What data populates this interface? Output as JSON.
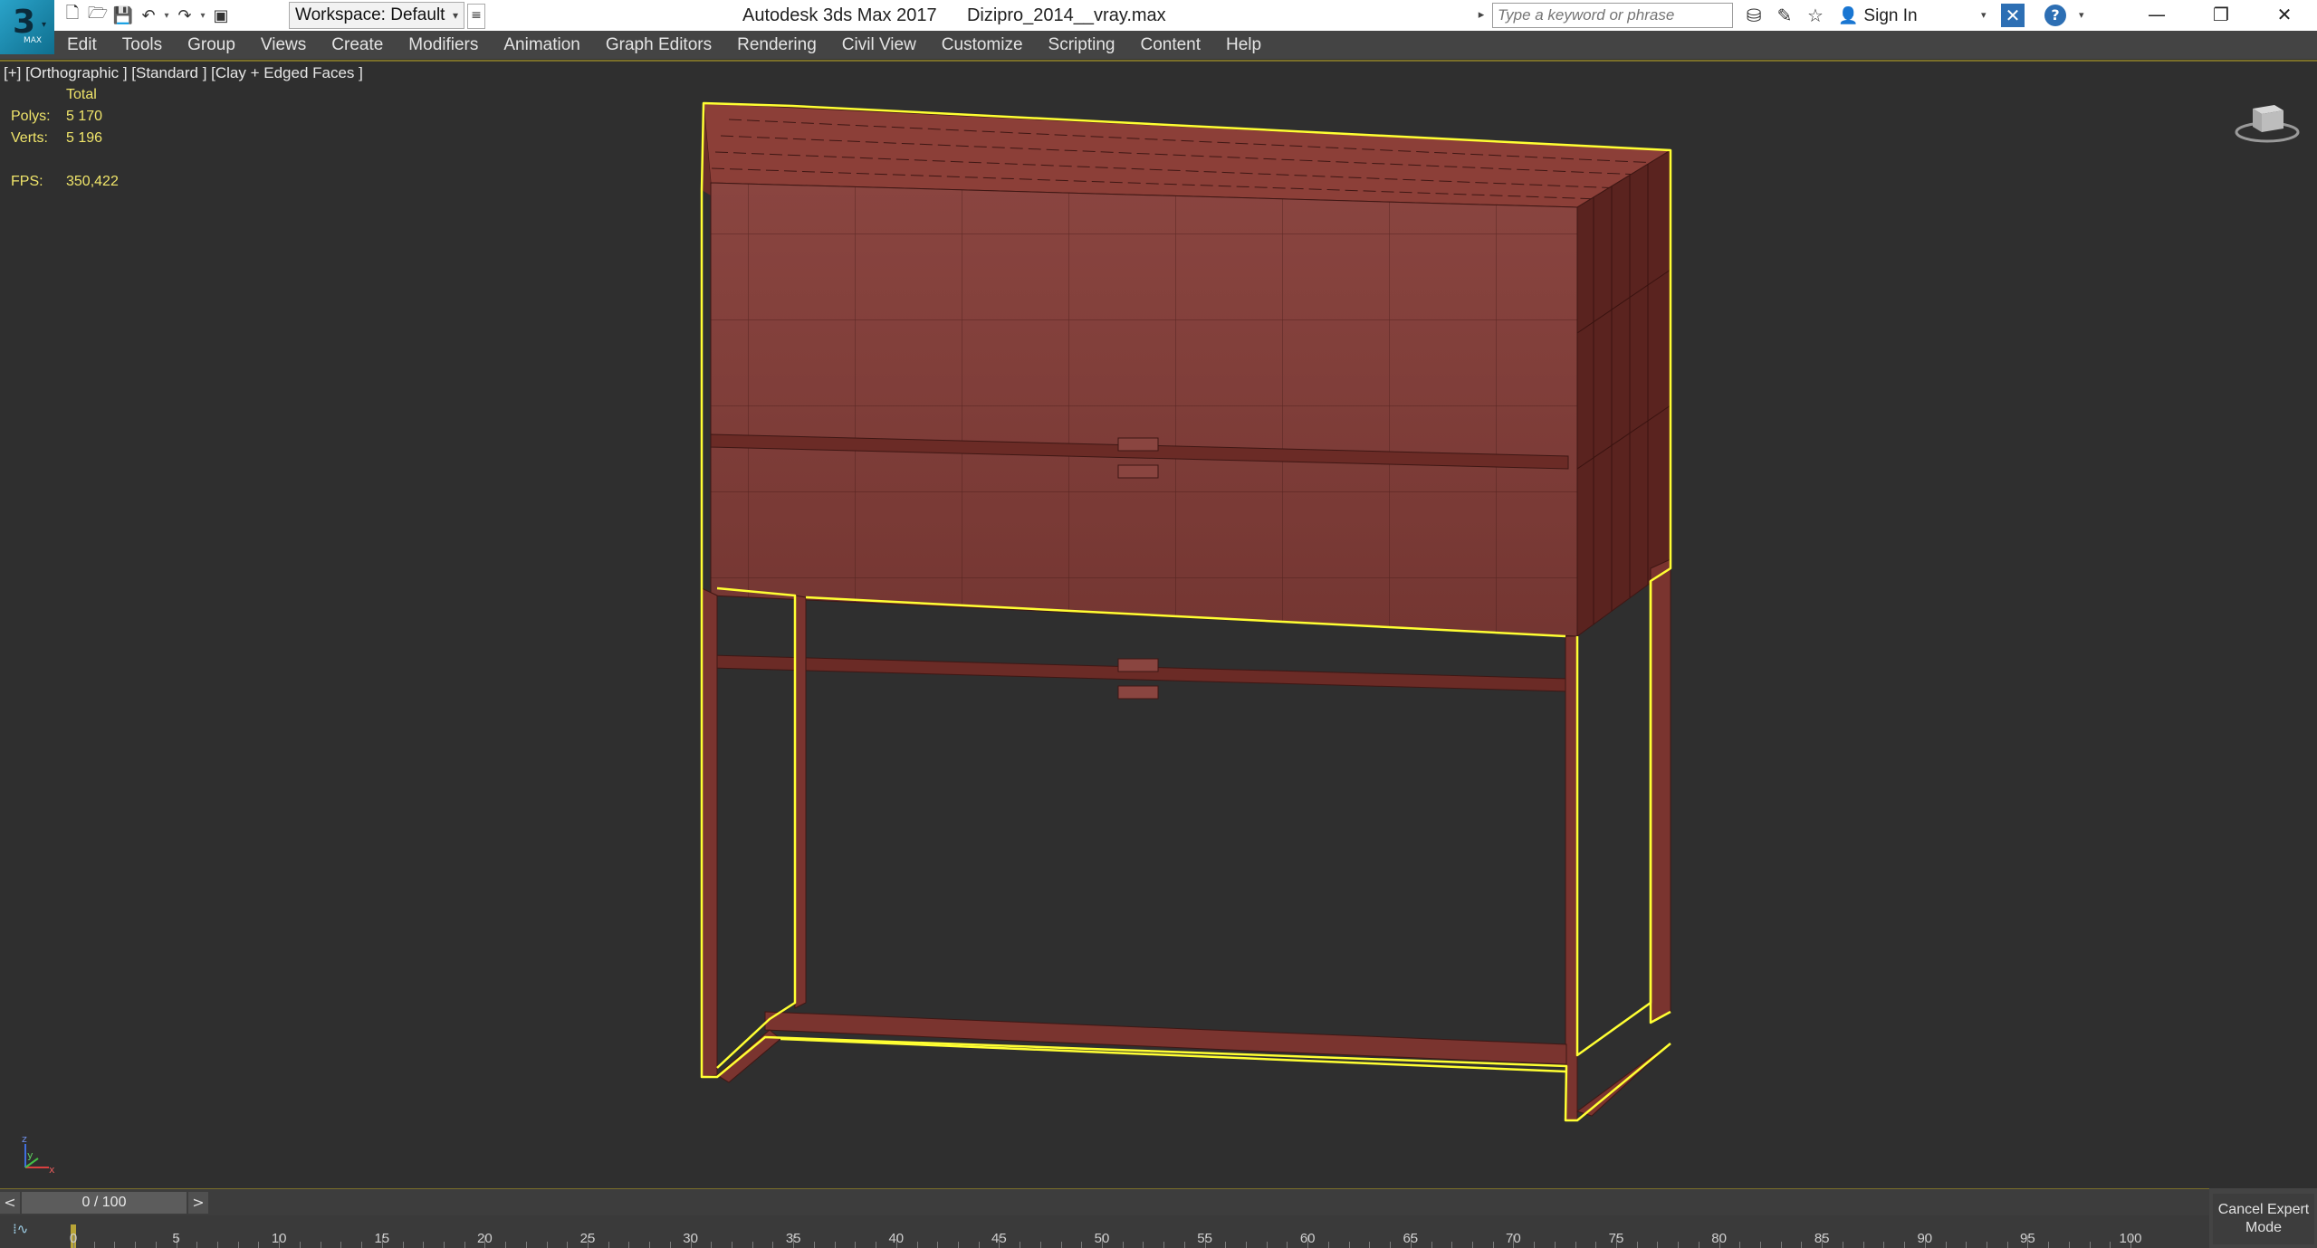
{
  "titlebar": {
    "app_name": "Autodesk 3ds Max 2017",
    "file_name": "Dizipro_2014__vray.max",
    "workspace_label": "Workspace: Default",
    "search_placeholder": "Type a keyword or phrase",
    "signin_label": "Sign In",
    "logo_number": "3",
    "logo_version": "MAX"
  },
  "menu": {
    "items": [
      "Edit",
      "Tools",
      "Group",
      "Views",
      "Create",
      "Modifiers",
      "Animation",
      "Graph Editors",
      "Rendering",
      "Civil View",
      "Customize",
      "Scripting",
      "Content",
      "Help"
    ]
  },
  "viewport": {
    "label": "[+] [Orthographic ] [Standard ] [Clay + Edged Faces ]",
    "stats": {
      "header": "Total",
      "polys_label": "Polys:",
      "polys_value": "5 170",
      "verts_label": "Verts:",
      "verts_value": "5 196",
      "fps_label": "FPS:",
      "fps_value": "350,422"
    },
    "axis": {
      "z": "z",
      "y": "y",
      "x": "x"
    }
  },
  "timeline": {
    "slider_label": "0 / 100",
    "prev": "<",
    "next": ">",
    "ticks": [
      "0",
      "5",
      "10",
      "15",
      "20",
      "25",
      "30",
      "35",
      "40",
      "45",
      "50",
      "55",
      "60",
      "65",
      "70",
      "75",
      "80",
      "85",
      "90",
      "95",
      "100"
    ],
    "current_frame": 0
  },
  "expert_mode": {
    "label": "Cancel Expert Mode"
  },
  "colors": {
    "model_fill": "#7e3b36",
    "model_dark": "#5e2622",
    "selection_outline": "#ffff33",
    "background": "#2f2f2f",
    "stats_text": "#f0e56a"
  },
  "icons": {
    "new": "new-file-icon",
    "open": "open-file-icon",
    "save": "save-icon",
    "undo": "undo-icon",
    "redo": "redo-icon",
    "project": "project-folder-icon",
    "binoculars": "binoculars-icon",
    "pin": "pin-icon",
    "star": "star-icon",
    "user": "user-icon",
    "autodesk_x": "x-exchange-icon",
    "help": "help-icon"
  }
}
